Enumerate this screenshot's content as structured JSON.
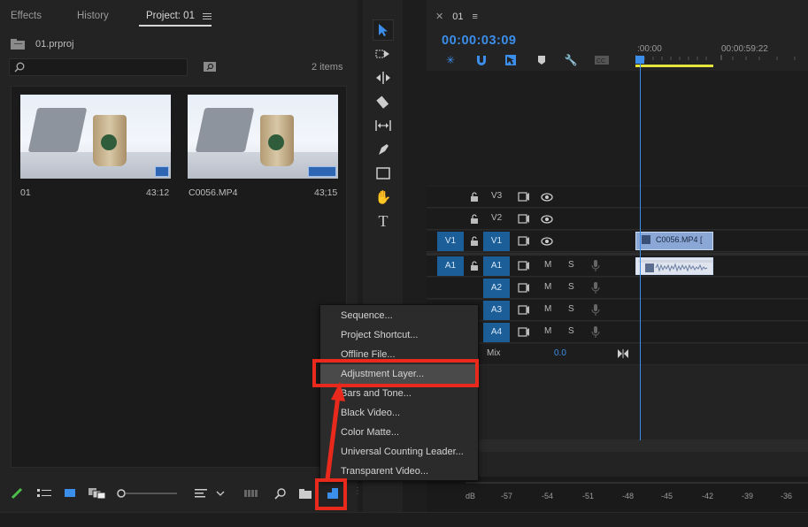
{
  "project_panel": {
    "tabs": [
      {
        "label": "Effects"
      },
      {
        "label": "History"
      },
      {
        "label": "Project: 01"
      }
    ],
    "file_name": "01.prproj",
    "search": {
      "placeholder": ""
    },
    "items_count": "2 items",
    "items": [
      {
        "name": "01",
        "duration": "43:12"
      },
      {
        "name": "C0056.MP4",
        "duration": "43;15"
      }
    ]
  },
  "timeline": {
    "sequence_tab": "01",
    "timecode": "00:00:03:09",
    "ruler_labels": [
      ":00:00",
      "00:00:59:22"
    ],
    "video_tracks": [
      {
        "name": "V3",
        "source": ""
      },
      {
        "name": "V2",
        "source": ""
      },
      {
        "name": "V1",
        "source": "V1"
      }
    ],
    "audio_tracks": [
      {
        "name": "A1",
        "source": "A1",
        "m": "M",
        "s": "S"
      },
      {
        "name": "A2",
        "source": "",
        "m": "M",
        "s": "S"
      },
      {
        "name": "A3",
        "source": "",
        "m": "M",
        "s": "S"
      },
      {
        "name": "A4",
        "source": "",
        "m": "M",
        "s": "S"
      }
    ],
    "mix_label": "Mix",
    "mix_value": "0.0",
    "clip_label": "C0056.MP4 [",
    "meter": {
      "labels": [
        "dB",
        "-57",
        "-54",
        "-51",
        "-48",
        "-45",
        "-42",
        "-39",
        "-36"
      ]
    }
  },
  "context_menu": {
    "items": [
      {
        "label": "Sequence..."
      },
      {
        "label": "Project Shortcut..."
      },
      {
        "label": "Offline File..."
      },
      {
        "label": "Adjustment Layer..."
      },
      {
        "label": "Bars and Tone..."
      },
      {
        "label": "Black Video..."
      },
      {
        "label": "Color Matte..."
      },
      {
        "label": "Universal Counting Leader..."
      },
      {
        "label": "Transparent Video..."
      }
    ],
    "highlighted": "Adjustment Layer..."
  },
  "colors": {
    "accent": "#3b8eea",
    "highlight": "#e8291c",
    "track_target": "#1c5e97",
    "clip": "#8aa7d6",
    "bg": "#232323"
  }
}
